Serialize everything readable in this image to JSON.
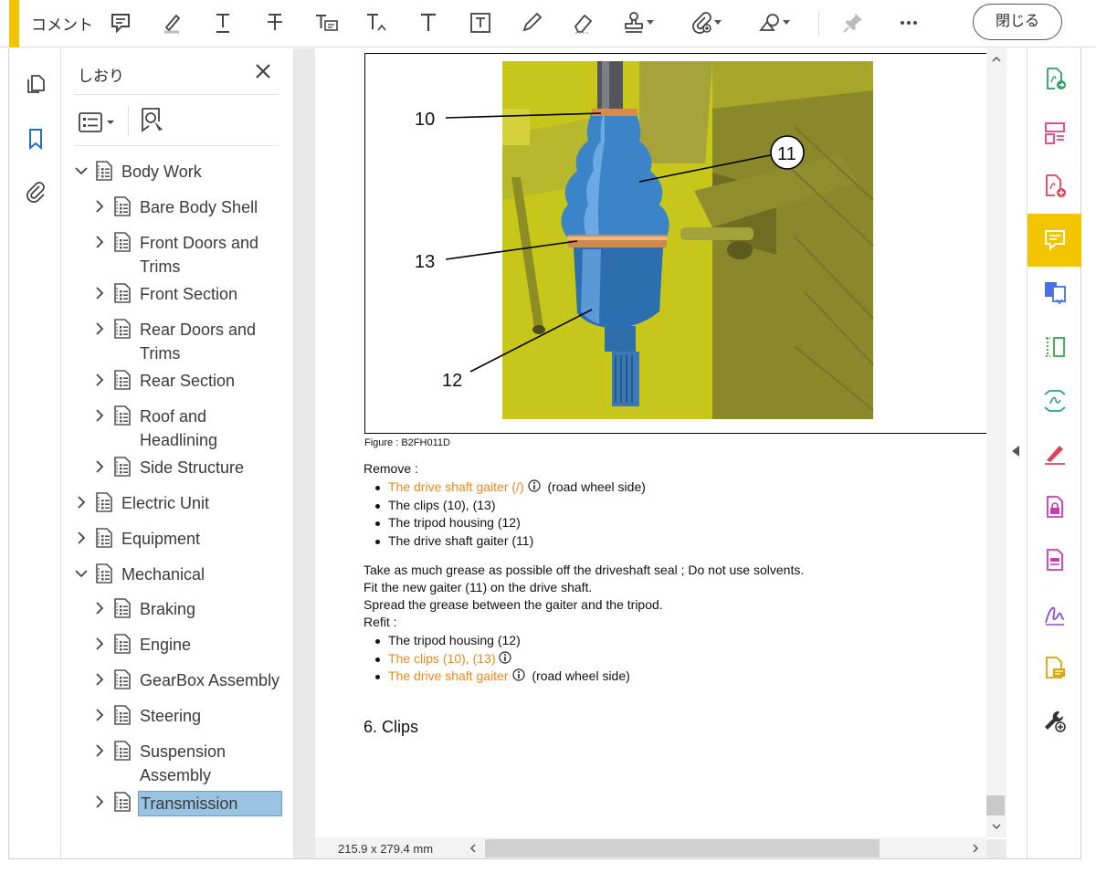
{
  "toolbar": {
    "title": "コメント",
    "close_label": "閉じる",
    "accent_color": "#f2c500",
    "tools": [
      "sticky-note",
      "highlight-pen",
      "underline-text",
      "strikethrough-text",
      "replace-text",
      "insert-text",
      "add-text",
      "text-box",
      "pencil",
      "eraser",
      "stamp",
      "attach-file",
      "shapes",
      "pin",
      "more"
    ]
  },
  "left_rail": {
    "icons": [
      "page-thumbnails",
      "bookmarks",
      "attachments"
    ]
  },
  "bookmarks": {
    "header": "しおり",
    "items": [
      {
        "label": "Body Work",
        "level": 0,
        "expanded": true
      },
      {
        "label": "Bare Body Shell",
        "level": 1,
        "expanded": false
      },
      {
        "label": "Front Doors and Trims",
        "level": 1,
        "expanded": false
      },
      {
        "label": "Front Section",
        "level": 1,
        "expanded": false
      },
      {
        "label": "Rear Doors and Trims",
        "level": 1,
        "expanded": false
      },
      {
        "label": "Rear Section",
        "level": 1,
        "expanded": false
      },
      {
        "label": "Roof and Headlining",
        "level": 1,
        "expanded": false
      },
      {
        "label": "Side Structure",
        "level": 1,
        "expanded": false
      },
      {
        "label": "Electric Unit",
        "level": 0,
        "expanded": false
      },
      {
        "label": "Equipment",
        "level": 0,
        "expanded": false
      },
      {
        "label": "Mechanical",
        "level": 0,
        "expanded": true
      },
      {
        "label": "Braking",
        "level": 1,
        "expanded": false
      },
      {
        "label": "Engine",
        "level": 1,
        "expanded": false
      },
      {
        "label": "GearBox Assembly",
        "level": 1,
        "expanded": false
      },
      {
        "label": "Steering",
        "level": 1,
        "expanded": false
      },
      {
        "label": "Suspension Assembly",
        "level": 1,
        "expanded": false
      },
      {
        "label": "Transmission",
        "level": 1,
        "expanded": false,
        "selected": true
      }
    ]
  },
  "document": {
    "figure": {
      "callouts": [
        "10",
        "11",
        "13",
        "12"
      ],
      "caption": "Figure : B2FH011D"
    },
    "remove_heading": "Remove :",
    "remove_items": [
      {
        "text": "The drive shaft gaiter (/)",
        "link": true,
        "info": true,
        "suffix": "(road wheel side)"
      },
      {
        "text": "The clips (10), (13)",
        "link": false,
        "info": false,
        "suffix": ""
      },
      {
        "text": "The tripod housing (12)",
        "link": false,
        "info": false,
        "suffix": ""
      },
      {
        "text": "The drive shaft gaiter (11)",
        "link": false,
        "info": false,
        "suffix": ""
      }
    ],
    "paragraphs": [
      "Take as much grease as possible off the driveshaft seal ; Do not use solvents.",
      "Fit the new gaiter (11) on the drive shaft.",
      "Spread the grease between the gaiter and the tripod.",
      "Refit :"
    ],
    "refit_items": [
      {
        "text": "The tripod housing (12)",
        "link": false,
        "info": false,
        "suffix": ""
      },
      {
        "text": "The clips (10), (13)",
        "link": true,
        "info": true,
        "suffix": ""
      },
      {
        "text": "The drive shaft gaiter",
        "link": true,
        "info": true,
        "suffix": "(road wheel side)"
      }
    ],
    "section_heading": "6. Clips",
    "link_color": "#e8891e"
  },
  "status": {
    "page_size": "215.9 x 279.4 mm"
  },
  "right_rail": {
    "tools": [
      {
        "name": "export-pdf",
        "color": "#2e9f6a"
      },
      {
        "name": "organize-pages",
        "color": "#e0407a"
      },
      {
        "name": "create-pdf",
        "color": "#e0405a"
      },
      {
        "name": "comment",
        "color": "#ffffff",
        "active": true
      },
      {
        "name": "combine-files",
        "color": "#4b6fe0"
      },
      {
        "name": "edit-pdf",
        "color": "#39a84a"
      },
      {
        "name": "scan-ocr",
        "color": "#2e9f9a"
      },
      {
        "name": "fill-sign",
        "color": "#e0405a"
      },
      {
        "name": "protect",
        "color": "#c83bb0"
      },
      {
        "name": "redact",
        "color": "#c83bb0"
      },
      {
        "name": "request-signature",
        "color": "#8a4bd6"
      },
      {
        "name": "send-for-comments",
        "color": "#d8a600"
      },
      {
        "name": "more-tools",
        "color": "#333333"
      }
    ]
  }
}
